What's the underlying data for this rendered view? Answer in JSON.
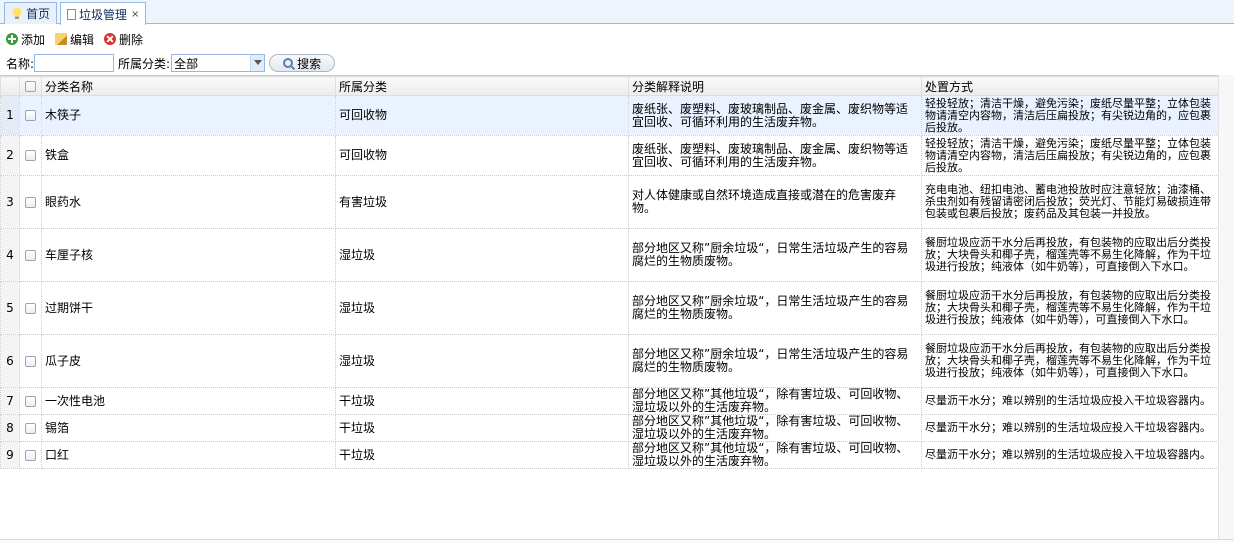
{
  "tabs": [
    {
      "label": "首页",
      "icon": "bulb-icon"
    },
    {
      "label": "垃圾管理",
      "icon": "document-icon",
      "closable": true
    }
  ],
  "toolbar": {
    "add_label": "添加",
    "edit_label": "编辑",
    "delete_label": "删除"
  },
  "search": {
    "name_label": "名称:",
    "name_value": "",
    "category_label": "所属分类:",
    "category_value": "全部",
    "search_label": "搜索"
  },
  "grid": {
    "columns": [
      "分类名称",
      "所属分类",
      "分类解释说明",
      "处置方式"
    ],
    "rows": [
      {
        "num": "1",
        "name": "木筷子",
        "category": "可回收物",
        "description": "废纸张、废塑料、废玻璃制品、废金属、废织物等适宜回收、可循环利用的生活废弃物。",
        "disposal": "轻投轻放；清洁干燥，避免污染；废纸尽量平整；立体包装物请清空内容物，清洁后压扁投放；有尖锐边角的，应包裹后投放。"
      },
      {
        "num": "2",
        "name": "铁盒",
        "category": "可回收物",
        "description": "废纸张、废塑料、废玻璃制品、废金属、废织物等适宜回收、可循环利用的生活废弃物。",
        "disposal": "轻投轻放；清洁干燥，避免污染；废纸尽量平整；立体包装物请清空内容物，清洁后压扁投放；有尖锐边角的，应包裹后投放。"
      },
      {
        "num": "3",
        "name": "眼药水",
        "category": "有害垃圾",
        "description": "对人体健康或自然环境造成直接或潜在的危害废弃物。",
        "disposal": "充电电池、纽扣电池、蓄电池投放时应注意轻放；油漆桶、杀虫剂如有残留请密闭后投放；荧光灯、节能灯易破损连带包装或包裹后投放；废药品及其包装一并投放。"
      },
      {
        "num": "4",
        "name": "车厘子核",
        "category": "湿垃圾",
        "description": "部分地区又称”厨余垃圾“，日常生活垃圾产生的容易腐烂的生物质废物。",
        "disposal": "餐厨垃圾应沥干水分后再投放，有包装物的应取出后分类投放；大块骨头和椰子壳，榴莲壳等不易生化降解，作为干垃圾进行投放；纯液体（如牛奶等），可直接倒入下水口。"
      },
      {
        "num": "5",
        "name": "过期饼干",
        "category": "湿垃圾",
        "description": "部分地区又称”厨余垃圾“，日常生活垃圾产生的容易腐烂的生物质废物。",
        "disposal": "餐厨垃圾应沥干水分后再投放，有包装物的应取出后分类投放；大块骨头和椰子壳，榴莲壳等不易生化降解，作为干垃圾进行投放；纯液体（如牛奶等），可直接倒入下水口。"
      },
      {
        "num": "6",
        "name": "瓜子皮",
        "category": "湿垃圾",
        "description": "部分地区又称”厨余垃圾“，日常生活垃圾产生的容易腐烂的生物质废物。",
        "disposal": "餐厨垃圾应沥干水分后再投放，有包装物的应取出后分类投放；大块骨头和椰子壳，榴莲壳等不易生化降解，作为干垃圾进行投放；纯液体（如牛奶等），可直接倒入下水口。"
      },
      {
        "num": "7",
        "name": "一次性电池",
        "category": "干垃圾",
        "description": "部分地区又称”其他垃圾“，除有害垃圾、可回收物、湿垃圾以外的生活废弃物。",
        "disposal": "尽量沥干水分；难以辨别的生活垃圾应投入干垃圾容器内。"
      },
      {
        "num": "8",
        "name": "锡箔",
        "category": "干垃圾",
        "description": "部分地区又称”其他垃圾“，除有害垃圾、可回收物、湿垃圾以外的生活废弃物。",
        "disposal": "尽量沥干水分；难以辨别的生活垃圾应投入干垃圾容器内。"
      },
      {
        "num": "9",
        "name": "口红",
        "category": "干垃圾",
        "description": "部分地区又称”其他垃圾“，除有害垃圾、可回收物、湿垃圾以外的生活废弃物。",
        "disposal": "尽量沥干水分；难以辨别的生活垃圾应投入干垃圾容器内。"
      }
    ]
  }
}
